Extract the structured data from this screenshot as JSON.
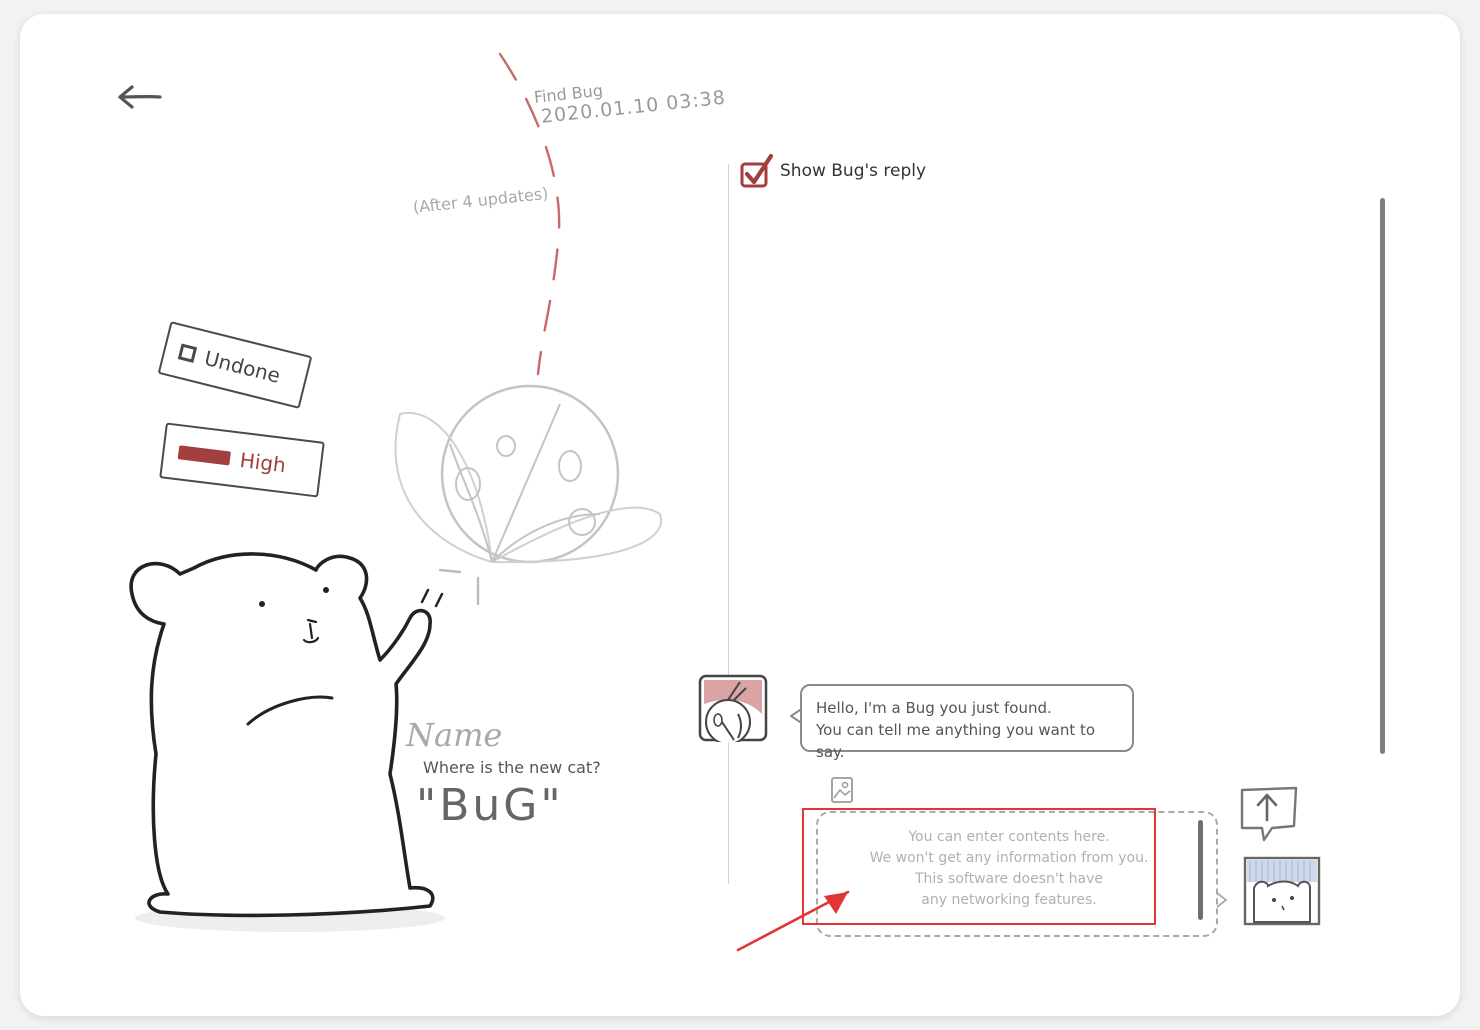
{
  "bug": {
    "find_label": "Find Bug",
    "find_date": "2020.01.10  03:38",
    "after_updates": "(After 4 updates)",
    "status_tag": "Undone",
    "priority_tag": "High",
    "name_label": "Name",
    "name_question": "Where is the new cat?",
    "name_value": "\"BuG\""
  },
  "chat": {
    "show_reply_label": "Show Bug's reply",
    "show_reply_checked": true,
    "messages": [
      {
        "line1": "Hello, I'm a Bug you just found.",
        "line2": "You can tell me anything you want to say."
      }
    ],
    "input_placeholder": "You can enter contents here.\nWe won't get any information from you.\nThis software doesn't have\nany networking features.",
    "input_value": ""
  },
  "icons": {
    "back": "back-arrow-icon",
    "image": "image-icon",
    "send": "send-up-arrow-icon",
    "avatar": "bug-avatar-icon",
    "stamp": "bear-stamp-icon",
    "checkbox": "check-icon"
  },
  "colors": {
    "accent_red": "#a23e3e",
    "annotation_red": "#e53434",
    "ink": "#4a4a4a"
  }
}
